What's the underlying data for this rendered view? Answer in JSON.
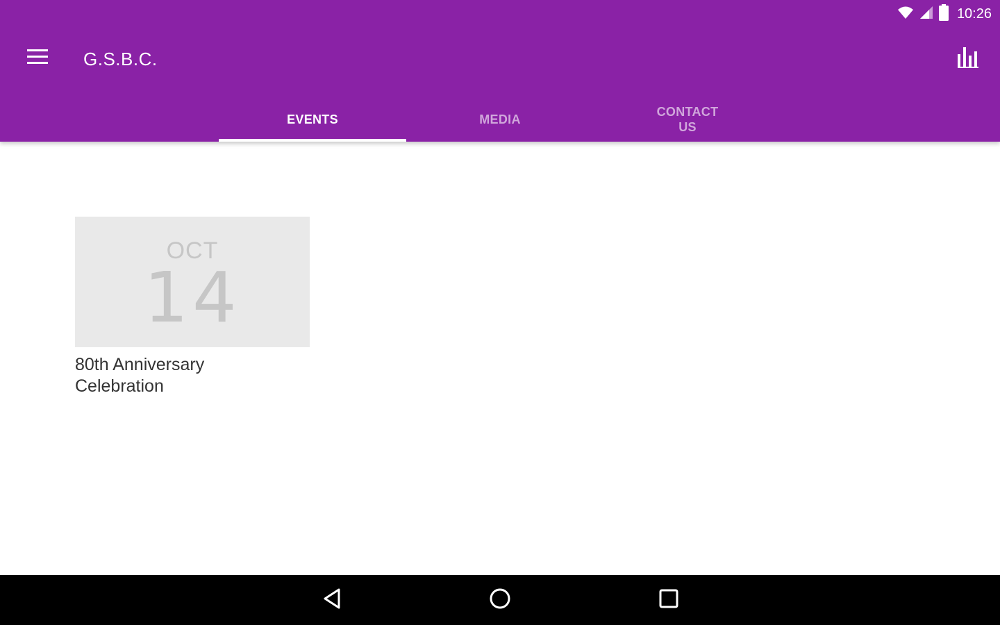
{
  "status_bar": {
    "time": "10:26",
    "icons": [
      "wifi-icon",
      "cell-signal-icon",
      "battery-icon"
    ]
  },
  "toolbar": {
    "title": "G.S.B.C.",
    "menu_icon": "menu-icon",
    "action_icon": "bar-chart-icon"
  },
  "tabs": [
    {
      "label": "EVENTS",
      "active": true
    },
    {
      "label": "MEDIA",
      "active": false
    },
    {
      "label": "CONTACT US",
      "active": false
    }
  ],
  "events": [
    {
      "month": "OCT",
      "day": "14",
      "title": "80th Anniversary Celebration"
    }
  ],
  "nav": {
    "icons": [
      "back-icon",
      "home-icon",
      "recents-icon"
    ]
  },
  "colors": {
    "primary": "#8a22a6",
    "tab_inactive": "rgba(255,255,255,0.6)",
    "date_box": "#e9e9e9",
    "nav_bar": "#000000"
  }
}
